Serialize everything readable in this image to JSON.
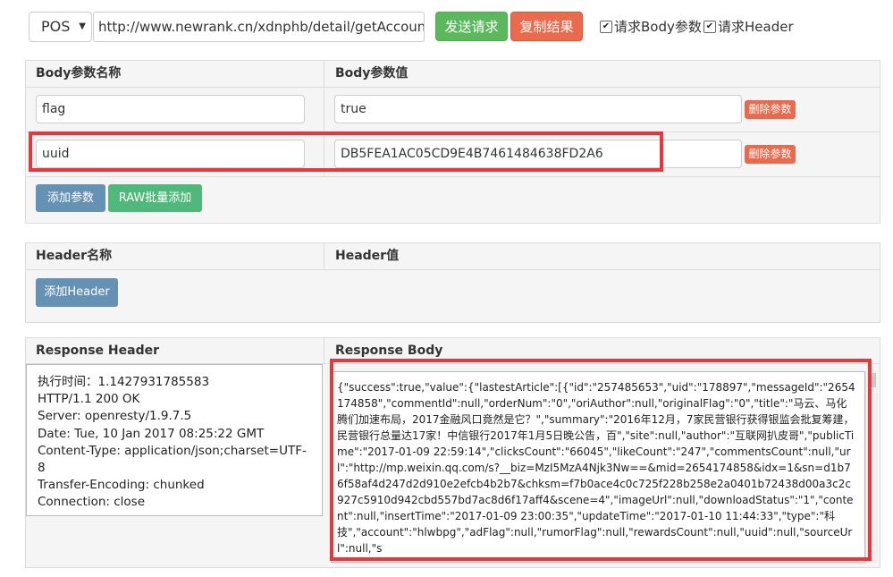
{
  "toolbar": {
    "method": "POS",
    "url": "http://www.newrank.cn/xdnphb/detail/getAccountArtic",
    "send_label": "发送请求",
    "copy_label": "复制结果",
    "body_param_label": "请求Body参数",
    "header_param_label": "请求Header",
    "body_param_checked": true,
    "header_param_checked": true
  },
  "body_params": {
    "name_header": "Body参数名称",
    "value_header": "Body参数值",
    "rows": [
      {
        "name": "flag",
        "value": "true",
        "delete_label": "删除参数"
      },
      {
        "name": "uuid",
        "value": "DB5FEA1AC05CD9E4B7461484638FD2A6",
        "delete_label": "删除参数"
      }
    ],
    "add_label": "添加参数",
    "raw_add_label": "RAW批量添加"
  },
  "header_params": {
    "name_header": "Header名称",
    "value_header": "Header值",
    "add_label": "添加Header"
  },
  "response": {
    "header_title": "Response Header",
    "body_title": "Response Body",
    "header_lines": [
      "执行时间：1.1427931785583",
      "HTTP/1.1 200 OK",
      "Server: openresty/1.9.7.5",
      "Date: Tue, 10 Jan 2017 08:25:22 GMT",
      "Content-Type: application/json;charset=UTF-8",
      "Transfer-Encoding: chunked",
      "Connection: close"
    ],
    "body_text": "{\"success\":true,\"value\":{\"lastestArticle\":[{\"id\":\"257485653\",\"uid\":\"178897\",\"messageId\":\"2654174858\",\"commentId\":null,\"orderNum\":\"0\",\"oriAuthor\":null,\"originalFlag\":\"0\",\"title\":\"马云、马化腾们加速布局，2017金融风口竟然是它？\",\"summary\":\"2016年12月，7家民营银行获得银监会批复筹建，民营银行总量达17家！中信银行2017年1月5日晚公告，百\",\"site\":null,\"author\":\"互联网扒皮哥\",\"publicTime\":\"2017-01-09 22:59:14\",\"clicksCount\":\"66045\",\"likeCount\":\"247\",\"commentsCount\":null,\"url\":\"http://mp.weixin.qq.com/s?__biz=MzI5MzA4Njk3Nw==&mid=2654174858&idx=1&sn=d1b76f58af4d247d2d910e2efcb4b2b7&chksm=f7b0ace4c0c725f228b258e2a0401b72438d00a3c2c927c5910d942cbd557bd7ac8d6f17aff4&scene=4\",\"imageUrl\":null,\"downloadStatus\":\"1\",\"content\":null,\"insertTime\":\"2017-01-09 23:00:35\",\"updateTime\":\"2017-01-10 11:44:33\",\"type\":\"科技\",\"account\":\"hlwbpg\",\"adFlag\":null,\"rumorFlag\":null,\"rewardsCount\":null,\"uuid\":null,\"sourceUrl\":null,\"s"
  },
  "colors": {
    "send": "#5cb85c",
    "copy": "#e96a4c",
    "add": "#6592b4",
    "raw_add": "#4fb87a",
    "highlight": "#e8363c"
  }
}
